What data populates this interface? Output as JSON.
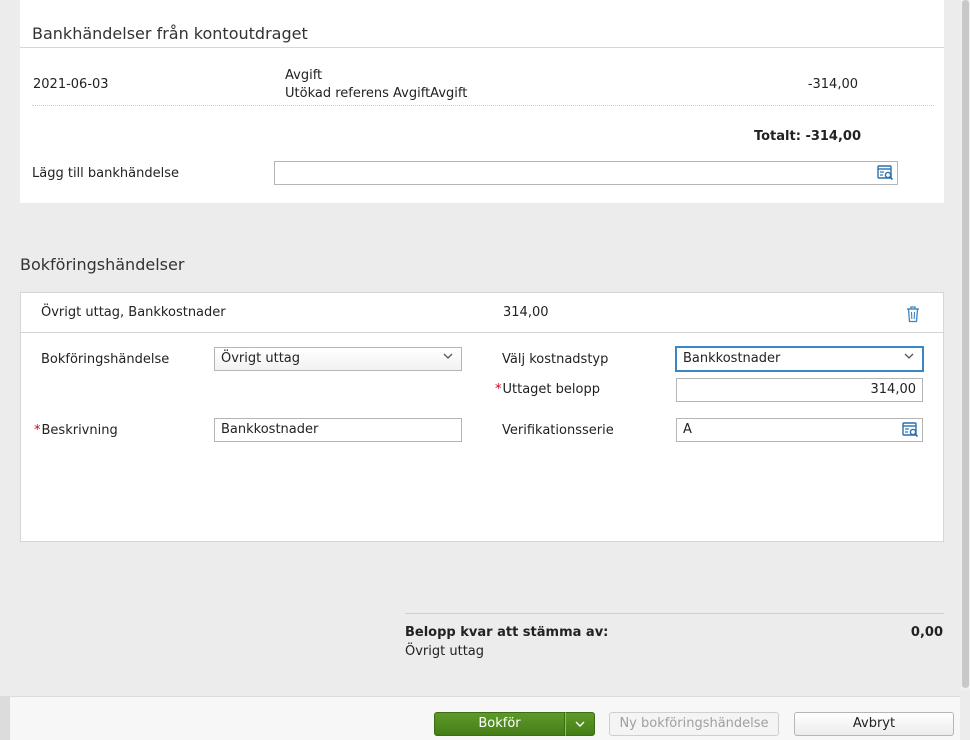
{
  "bank": {
    "title": "Bankhändelser från kontoutdraget",
    "transaction": {
      "date": "2021-06-03",
      "name": "Avgift",
      "reference": "Utökad referens AvgiftAvgift",
      "amount": "-314,00"
    },
    "total": "Totalt: -314,00",
    "add_label": "Lägg till bankhändelse",
    "add_value": "",
    "lookup_icon": "lookup-search-icon"
  },
  "posting": {
    "title": "Bokföringshändelser",
    "header_text": "Övrigt uttag, Bankkostnader",
    "header_amount": "314,00",
    "delete_icon": "trash-icon",
    "fields": {
      "event_label": "Bokföringshändelse",
      "event_value": "Övrigt uttag",
      "cost_type_label": "Välj kostnadstyp",
      "cost_type_value": "Bankkostnader",
      "amount_label": "Uttaget belopp",
      "amount_value": "314,00",
      "description_label": "Beskrivning",
      "description_value": "Bankkostnader",
      "series_label": "Verifikationsserie",
      "series_value": "A",
      "required_marker": "*"
    },
    "colors": {
      "required": "#d0021b",
      "focus": "#3b86c4",
      "primary": "#4c8a1f"
    }
  },
  "summary": {
    "label": "Belopp kvar att stämma av:",
    "amount": "0,00",
    "sub": "Övrigt uttag"
  },
  "footer": {
    "primary_label": "Bokför",
    "split_icon": "chevron-down-icon",
    "new_label": "Ny bokföringshändelse",
    "cancel_label": "Avbryt"
  }
}
